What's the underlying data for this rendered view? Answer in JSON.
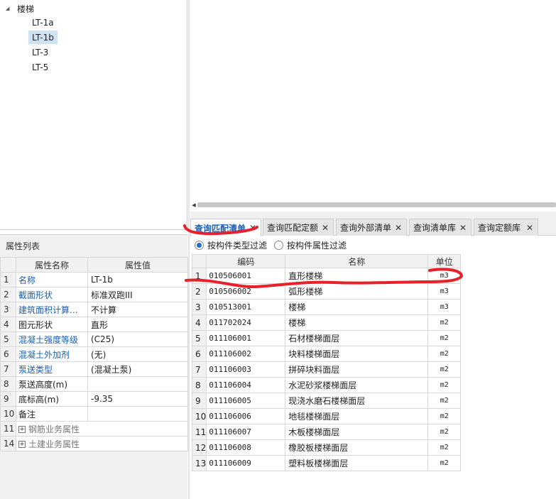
{
  "tree": {
    "root_label": "楼梯",
    "children": [
      {
        "label": "LT-1a",
        "selected": false
      },
      {
        "label": "LT-1b",
        "selected": true
      },
      {
        "label": "LT-3",
        "selected": false
      },
      {
        "label": "LT-5",
        "selected": false
      }
    ]
  },
  "properties": {
    "panel_title": "属性列表",
    "header_name": "属性名称",
    "header_value": "属性值",
    "rows": [
      {
        "num": "1",
        "name": "名称",
        "value": "LT-1b",
        "blue": true
      },
      {
        "num": "2",
        "name": "截面形状",
        "value": "标准双跑III",
        "blue": true
      },
      {
        "num": "3",
        "name": "建筑面积计算...",
        "value": "不计算",
        "blue": true
      },
      {
        "num": "4",
        "name": "图元形状",
        "value": "直形",
        "blue": false
      },
      {
        "num": "5",
        "name": "混凝土强度等级",
        "value": "(C25)",
        "blue": true
      },
      {
        "num": "6",
        "name": "混凝土外加剂",
        "value": "(无)",
        "blue": true
      },
      {
        "num": "7",
        "name": "泵送类型",
        "value": "(混凝土泵)",
        "blue": true
      },
      {
        "num": "8",
        "name": "泵送高度(m)",
        "value": "",
        "blue": false
      },
      {
        "num": "9",
        "name": "底标高(m)",
        "value": "-9.35",
        "blue": false
      },
      {
        "num": "10",
        "name": "备注",
        "value": "",
        "blue": false
      }
    ],
    "groups": [
      {
        "num": "11",
        "name": "钢筋业务属性",
        "expand": "+"
      },
      {
        "num": "14",
        "name": "土建业务属性",
        "expand": "+"
      }
    ]
  },
  "query": {
    "tabs": [
      {
        "label": "查询匹配清单",
        "active": true
      },
      {
        "label": "查询匹配定额",
        "active": false
      },
      {
        "label": "查询外部清单",
        "active": false
      },
      {
        "label": "查询清单库",
        "active": false
      },
      {
        "label": "查询定额库",
        "active": false
      }
    ],
    "close_glyph": "✕",
    "filter": {
      "option1": "按构件类型过滤",
      "option2": "按构件属性过滤",
      "selected": 1
    },
    "table": {
      "headers": {
        "code": "编码",
        "name": "名称",
        "unit": "单位"
      },
      "rows": [
        {
          "num": "1",
          "code": "010506001",
          "name": "直形楼梯",
          "unit": "m3"
        },
        {
          "num": "2",
          "code": "010506002",
          "name": "弧形楼梯",
          "unit": "m3"
        },
        {
          "num": "3",
          "code": "010513001",
          "name": "楼梯",
          "unit": "m3"
        },
        {
          "num": "4",
          "code": "011702024",
          "name": "楼梯",
          "unit": "m2"
        },
        {
          "num": "5",
          "code": "011106001",
          "name": "石材楼梯面层",
          "unit": "m2"
        },
        {
          "num": "6",
          "code": "011106002",
          "name": "块料楼梯面层",
          "unit": "m2"
        },
        {
          "num": "7",
          "code": "011106003",
          "name": "拼碎块料面层",
          "unit": "m2"
        },
        {
          "num": "8",
          "code": "011106004",
          "name": "水泥砂浆楼梯面层",
          "unit": "m2"
        },
        {
          "num": "9",
          "code": "011106005",
          "name": "现浇水磨石楼梯面层",
          "unit": "m2"
        },
        {
          "num": "10",
          "code": "011106006",
          "name": "地毯楼梯面层",
          "unit": "m2"
        },
        {
          "num": "11",
          "code": "011106007",
          "name": "木板楼梯面层",
          "unit": "m2"
        },
        {
          "num": "12",
          "code": "011106008",
          "name": "橡胶板楼梯面层",
          "unit": "m2"
        },
        {
          "num": "13",
          "code": "011106009",
          "name": "塑料板楼梯面层",
          "unit": "m2"
        }
      ]
    }
  },
  "colors": {
    "accent": "#1a5fb4",
    "annotation": "#e8202a",
    "selection": "#cfe3f5"
  }
}
